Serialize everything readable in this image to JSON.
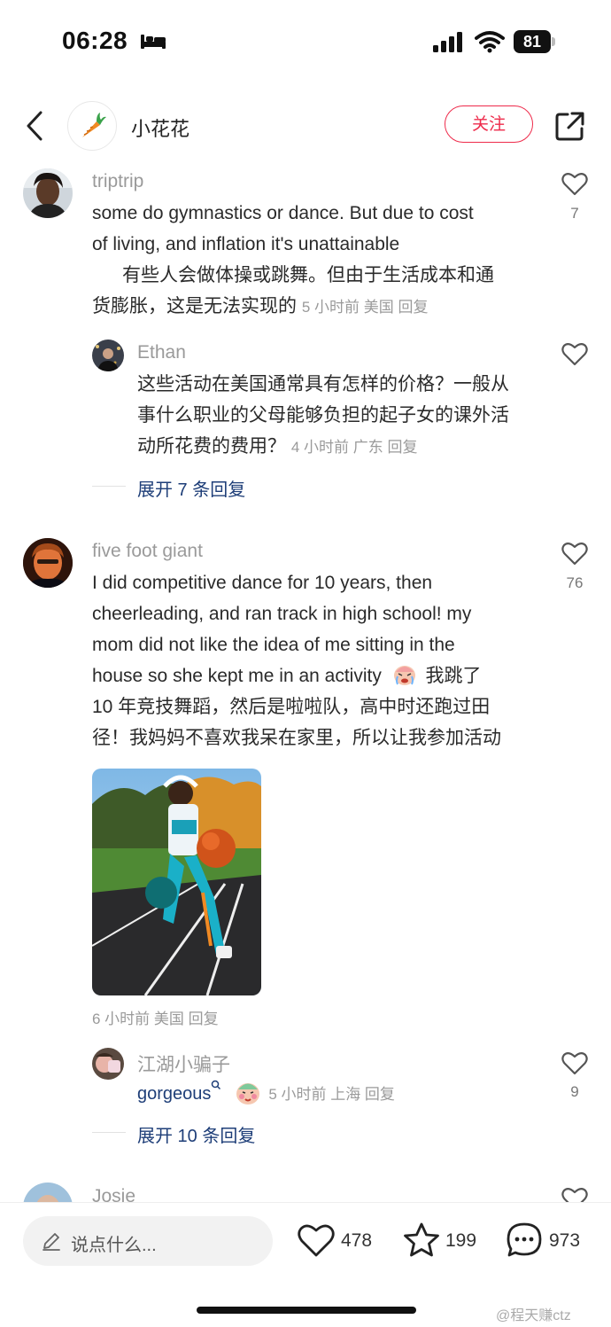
{
  "status_bar": {
    "time": "06:28",
    "battery": "81"
  },
  "header": {
    "author_name": "小花花",
    "follow_label": "关注"
  },
  "comments": [
    {
      "username": "triptrip",
      "lines": [
        "some do gymnastics or dance. But due to cost",
        "of living, and inflation it's unattainable",
        "有些人会做体操或跳舞。但由于生活成本和通",
        "货膨胀，这是无法实现的"
      ],
      "meta": "5 小时前  美国  回复",
      "likes": "7",
      "reply": {
        "username": "Ethan",
        "lines": [
          "这些活动在美国通常具有怎样的价格？一般从",
          "事什么职业的父母能够负担的起子女的课外活",
          "动所花费的费用？"
        ],
        "meta": "4 小时前  广东  回复"
      },
      "expand": "展开 7 条回复"
    },
    {
      "username": "five foot giant",
      "lines": [
        "I did competitive dance for 10 years, then",
        "cheerleading, and ran track in high school! my",
        "mom did not like the idea of me sitting in the",
        "house so she kept me in an activity",
        "我跳了",
        "10 年竞技舞蹈，然后是啦啦队，高中时还跑过田",
        "径！我妈妈不喜欢我呆在家里，所以让我参加活动"
      ],
      "meta": "6 小时前  美国  回复",
      "likes": "76",
      "reply": {
        "username": "江湖小骗子",
        "text": "gorgeous",
        "meta": "5 小时前  上海  回复",
        "likes": "9"
      },
      "expand": "展开 10 条回复"
    },
    {
      "username": "Josie"
    }
  ],
  "bottom_bar": {
    "input_placeholder": "说点什么...",
    "likes": "478",
    "stars": "199",
    "comments": "973"
  },
  "watermark": "@程天赚ctz",
  "colors": {
    "accent": "#ee2a4a",
    "link": "#1e3e78",
    "muted": "#9a9a9a"
  }
}
